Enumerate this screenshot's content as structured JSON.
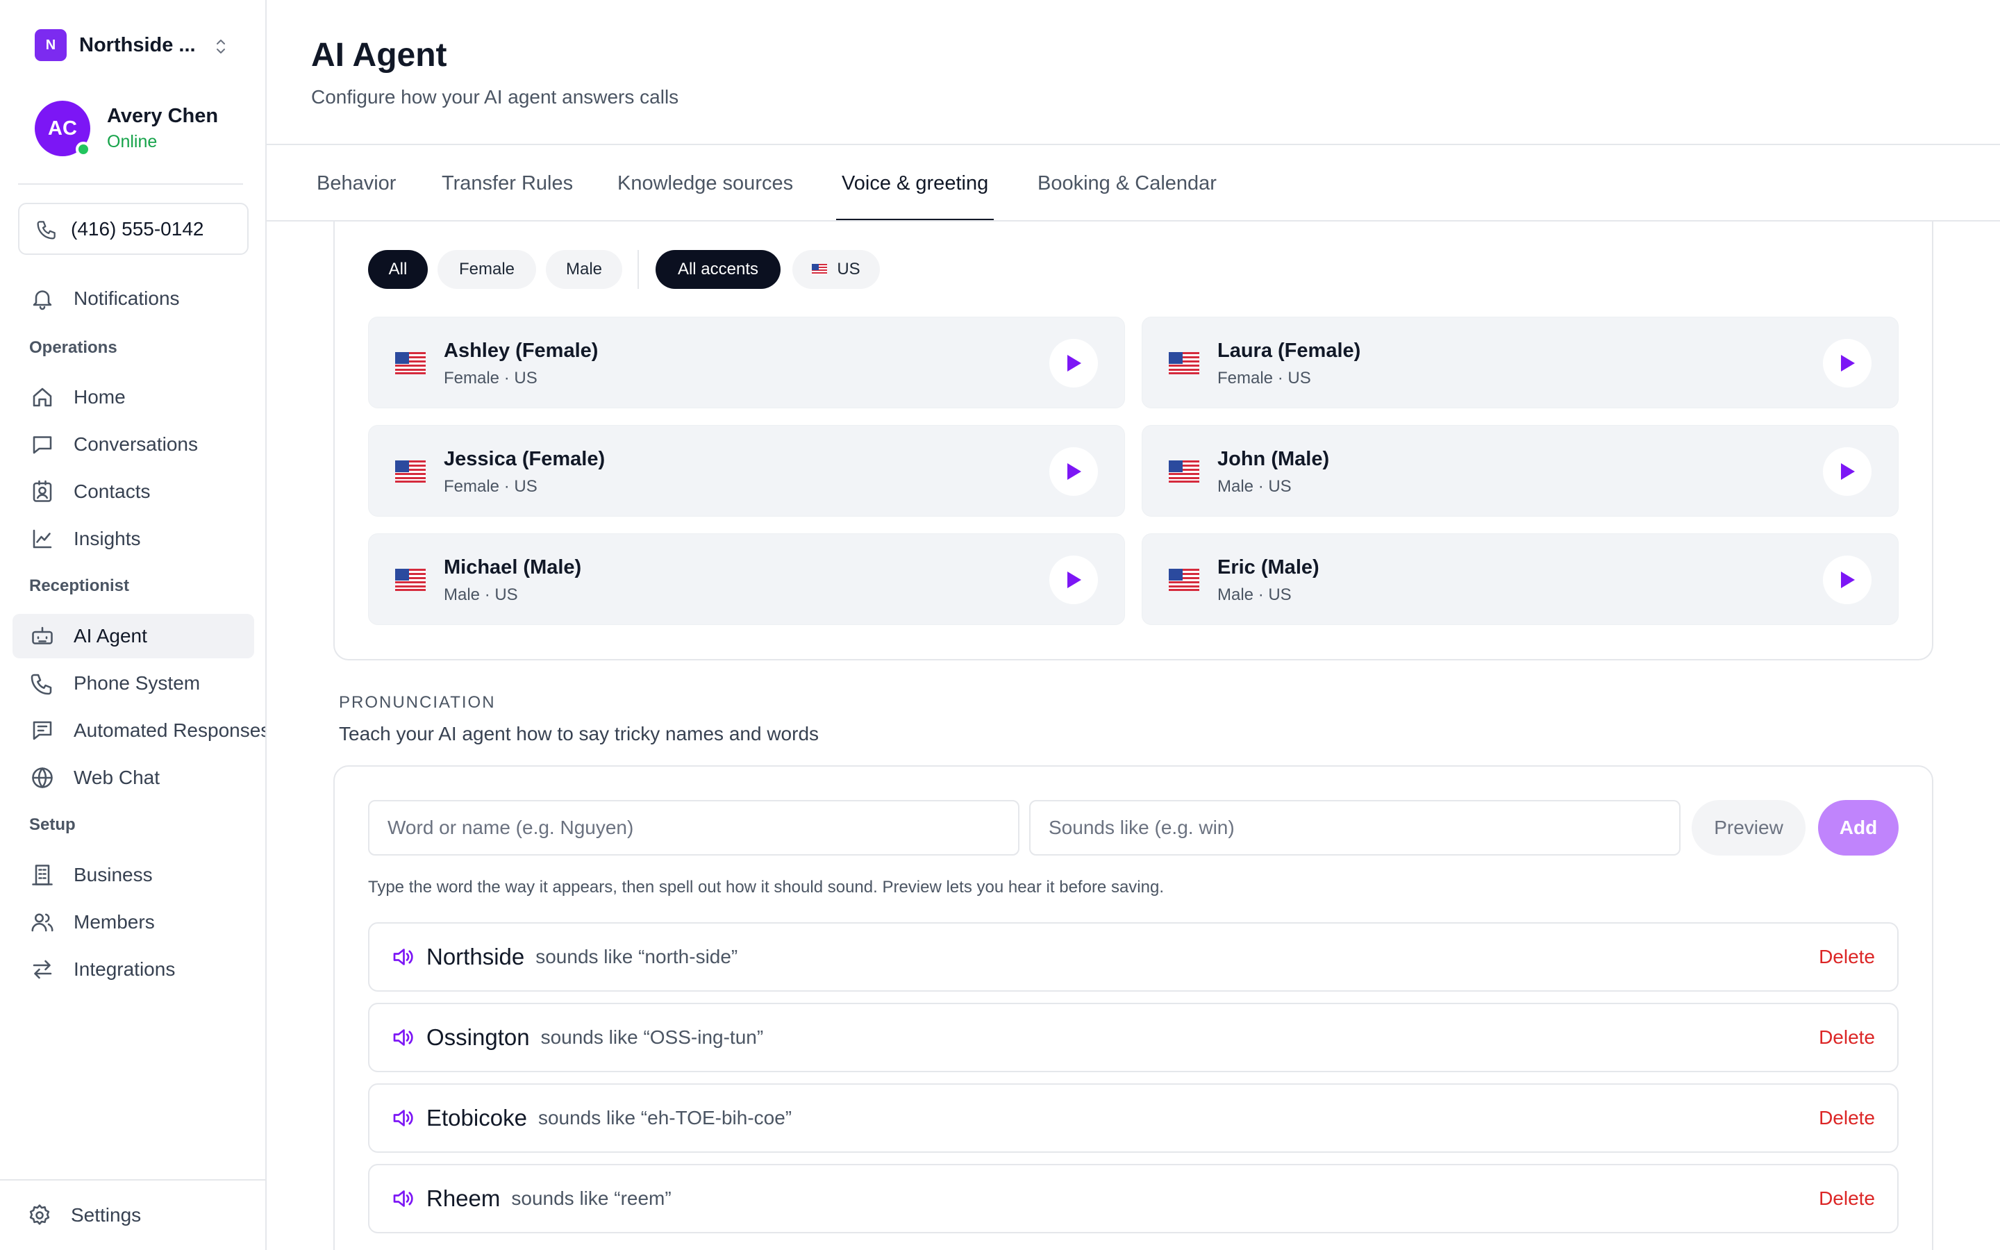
{
  "workspace": {
    "initial": "N",
    "name": "Northside ..."
  },
  "user": {
    "initials": "AC",
    "name": "Avery Chen",
    "status": "Online"
  },
  "phone_number": "(416) 555-0142",
  "nav": {
    "notifications": {
      "label": "Notifications",
      "icon": "bell-icon"
    },
    "sections": {
      "operations": "Operations",
      "receptionist": "Receptionist",
      "setup": "Setup"
    },
    "items": [
      {
        "label": "Home",
        "icon": "home-icon"
      },
      {
        "label": "Conversations",
        "icon": "chat-icon"
      },
      {
        "label": "Contacts",
        "icon": "contacts-icon"
      },
      {
        "label": "Insights",
        "icon": "chart-icon"
      },
      {
        "label": "AI Agent",
        "icon": "robot-icon",
        "active": true
      },
      {
        "label": "Phone System",
        "icon": "phone-icon"
      },
      {
        "label": "Automated Responses",
        "icon": "message-icon"
      },
      {
        "label": "Web Chat",
        "icon": "globe-icon"
      },
      {
        "label": "Business",
        "icon": "building-icon"
      },
      {
        "label": "Members",
        "icon": "users-icon"
      },
      {
        "label": "Integrations",
        "icon": "arrows-icon"
      }
    ],
    "settings": {
      "label": "Settings",
      "icon": "gear-icon"
    }
  },
  "page": {
    "title": "AI Agent",
    "subtitle": "Configure how your AI agent answers calls"
  },
  "tabs": [
    {
      "label": "Behavior"
    },
    {
      "label": "Transfer Rules"
    },
    {
      "label": "Knowledge sources"
    },
    {
      "label": "Voice & greeting",
      "active": true
    },
    {
      "label": "Booking & Calendar"
    }
  ],
  "filters": {
    "gender": [
      {
        "label": "All",
        "selected": true
      },
      {
        "label": "Female"
      },
      {
        "label": "Male"
      }
    ],
    "accent": [
      {
        "label": "All accents",
        "selected": true
      },
      {
        "label": "US",
        "icon": "us-flag-icon"
      }
    ]
  },
  "voices": [
    {
      "name": "Ashley (Female)",
      "meta": "Female · US"
    },
    {
      "name": "Laura (Female)",
      "meta": "Female · US"
    },
    {
      "name": "Jessica (Female)",
      "meta": "Female · US"
    },
    {
      "name": "John (Male)",
      "meta": "Male · US"
    },
    {
      "name": "Michael (Male)",
      "meta": "Male · US"
    },
    {
      "name": "Eric (Male)",
      "meta": "Male · US"
    }
  ],
  "pronunciation": {
    "label": "PRONUNCIATION",
    "subtitle": "Teach your AI agent how to say tricky names and words",
    "word_placeholder": "Word or name (e.g. Nguyen)",
    "sounds_placeholder": "Sounds like (e.g. win)",
    "preview_label": "Preview",
    "add_label": "Add",
    "hint": "Type the word the way it appears, then spell out how it should sound. Preview lets you hear it before saving.",
    "entries": [
      {
        "word": "Northside",
        "sounds": "sounds like “north-side”",
        "delete": "Delete"
      },
      {
        "word": "Ossington",
        "sounds": "sounds like “OSS-ing-tun”",
        "delete": "Delete"
      },
      {
        "word": "Etobicoke",
        "sounds": "sounds like “eh-TOE-bih-coe”",
        "delete": "Delete"
      },
      {
        "word": "Rheem",
        "sounds": "sounds like “reem”",
        "delete": "Delete"
      }
    ]
  },
  "colors": {
    "accent": "#7c2bf0",
    "add_button": "#c084fc",
    "delete": "#dc2626",
    "online": "#16a34a"
  }
}
